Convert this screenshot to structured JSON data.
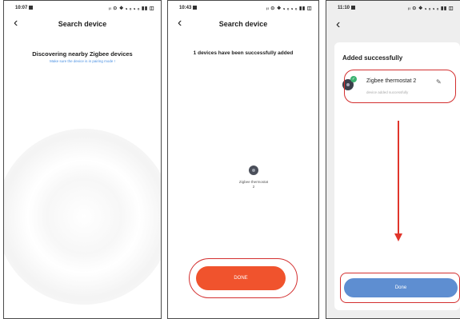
{
  "screens": [
    {
      "status_time": "10:07",
      "status_icons": "ᵢₗ ⊙ ❖ ₛ ₒ ₛ ₒ ▮▮ ◫",
      "title": "Search device",
      "heading": "Discovering nearby Zigbee devices",
      "hint": "Make sure the device is in pairing mode !"
    },
    {
      "status_time": "10:43",
      "status_icons": "ᵢₗ ⊙ ❖ ₛ ₒ ₛ ₒ ▮▮ ◫",
      "title": "Search device",
      "heading": "1 devices have been successfully added",
      "device_name": "Zigbee thermostat 2",
      "done_label": "DONE"
    },
    {
      "status_time": "11:10",
      "status_icons": "ᵢₗ ⊙ ❖ ₛ ₒ ₛ ₒ ▮▮ ◫",
      "heading": "Added successfully",
      "device_name": "Zigbee thermostat 2",
      "device_status": "device added successfully",
      "done_label": "Done"
    }
  ],
  "colors": {
    "accent_red": "#f0532d",
    "accent_blue": "#5e8ed1",
    "annotation_red": "#d32f2f",
    "success_green": "#3cb371"
  }
}
